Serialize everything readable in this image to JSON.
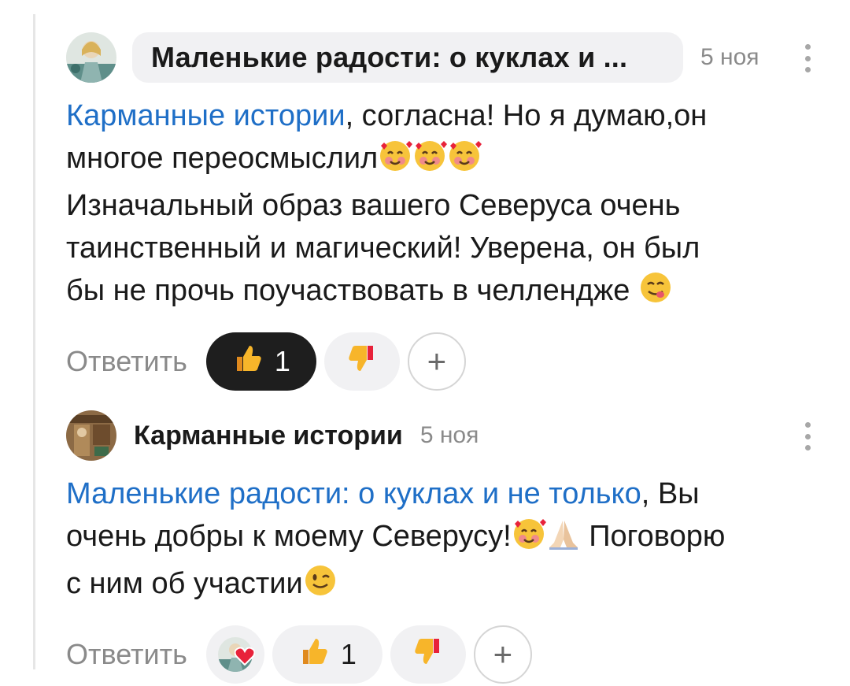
{
  "comments": [
    {
      "author": "Маленькие радости: о куклах и ...",
      "date": "5 ноя",
      "lines": [
        {
          "mention": "Карманные истории",
          "text": ", согласна! Но я думаю,он"
        },
        {
          "text": "многое переосмыслил"
        },
        {
          "text": "Изначальный образ вашего Северуса очень"
        },
        {
          "text": "таинственный и магический! Уверена, он был"
        },
        {
          "text": "бы не прочь поучаствовать в челлендже "
        }
      ],
      "reply_label": "Ответить",
      "likes": "1",
      "add_label": "+"
    },
    {
      "author": "Карманные истории",
      "date": "5 ноя",
      "lines": [
        {
          "mention": "Маленькие радости: о куклах и не только",
          "text": ", Вы"
        },
        {
          "text": "очень добры к моему Северусу!",
          "text_after": " Поговорю"
        },
        {
          "text": "с ним об участии"
        }
      ],
      "reply_label": "Ответить",
      "likes": "1",
      "add_label": "+"
    }
  ],
  "icons": [
    "kebab-menu-icon",
    "thumbs-up-icon",
    "thumbs-down-icon",
    "plus-icon",
    "heart-icon",
    "smiling-face-with-hearts-emoji",
    "yum-face-emoji",
    "folded-hands-emoji",
    "winking-face-emoji"
  ],
  "colors": {
    "mention": "#1f6fc7",
    "muted": "#8a8a8a",
    "active_reaction_bg": "#1e1e1e",
    "pill_bg": "#f1f1f3",
    "heart": "#e8223a"
  }
}
